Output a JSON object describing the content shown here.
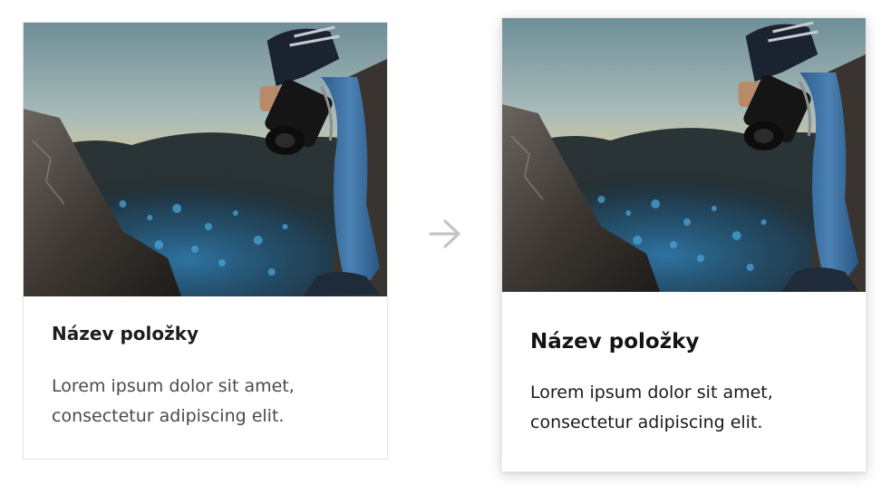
{
  "cards": [
    {
      "state": "default",
      "image_icon": "photographer-photo",
      "title": "Název položky",
      "text": "Lorem ipsum dolor sit amet, consectetur adipiscing elit."
    },
    {
      "state": "hover",
      "image_icon": "photographer-photo",
      "title": "Název položky",
      "text": "Lorem ipsum dolor sit amet, consectetur adipiscing elit."
    }
  ],
  "transition_icon": "arrow-right-icon",
  "colors": {
    "arrow": "#c4c4c4",
    "card_border": "#e2e2e2",
    "title_text": "#1e1e1e",
    "body_text": "#4a4a4a"
  }
}
